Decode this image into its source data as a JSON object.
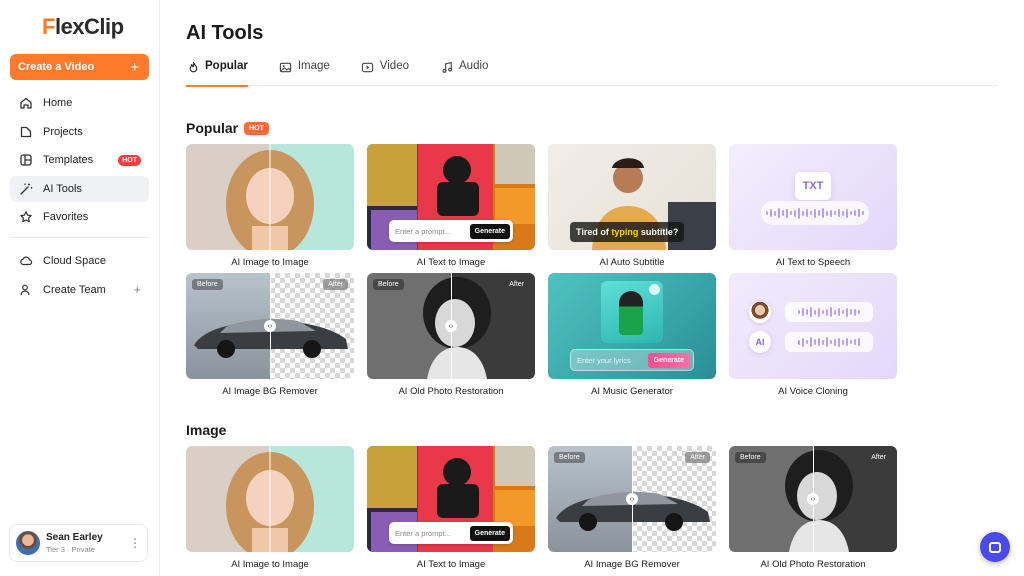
{
  "brand": {
    "logo_f": "F",
    "logo_rest": "lexClip"
  },
  "sidebar": {
    "create_label": "Create a Video",
    "items": [
      {
        "label": "Home",
        "icon": "home-icon"
      },
      {
        "label": "Projects",
        "icon": "folder-icon"
      },
      {
        "label": "Templates",
        "icon": "templates-icon",
        "badge": "HOT"
      },
      {
        "label": "AI Tools",
        "icon": "magic-wand-icon",
        "active": true
      },
      {
        "label": "Favorites",
        "icon": "star-icon"
      }
    ],
    "secondary": [
      {
        "label": "Cloud Space",
        "icon": "cloud-icon"
      },
      {
        "label": "Create Team",
        "icon": "team-icon"
      }
    ],
    "user": {
      "name": "Sean Earley",
      "tier": "Tier 3 · Private"
    }
  },
  "main": {
    "title": "AI Tools",
    "tabs": [
      {
        "label": "Popular",
        "icon": "flame-icon",
        "active": true
      },
      {
        "label": "Image",
        "icon": "image-icon"
      },
      {
        "label": "Video",
        "icon": "video-icon"
      },
      {
        "label": "Audio",
        "icon": "music-note-icon"
      }
    ],
    "popular": {
      "heading": "Popular",
      "badge": "HOT",
      "cards": [
        {
          "label": "AI Image to Image"
        },
        {
          "label": "AI Text to Image",
          "prompt_placeholder": "Enter a prompt...",
          "button": "Generate"
        },
        {
          "label": "AI Auto Subtitle",
          "caption_pre": "Tired of ",
          "caption_hl": "typing",
          "caption_post": " subtitle?"
        },
        {
          "label": "AI Text to Speech",
          "doc_text": "TXT"
        },
        {
          "label": "AI Image BG Remover",
          "before": "Before",
          "after": "After"
        },
        {
          "label": "AI Old Photo Restoration",
          "before": "Before",
          "after": "After"
        },
        {
          "label": "AI Music Generator",
          "prompt_placeholder": "Enter your lyrics",
          "button": "Generate"
        },
        {
          "label": "AI Voice Cloning",
          "ai_text": "AI"
        }
      ]
    },
    "image": {
      "heading": "Image",
      "cards": [
        {
          "label": "AI Image to Image"
        },
        {
          "label": "AI Text to Image",
          "prompt_placeholder": "Enter a prompt...",
          "button": "Generate"
        },
        {
          "label": "AI Image BG Remover",
          "before": "Before",
          "after": "After"
        },
        {
          "label": "AI Old Photo Restoration",
          "before": "Before",
          "after": "After"
        }
      ]
    }
  },
  "colors": {
    "accent": "#ff7a2c",
    "hot": "#ff3b3b",
    "help": "#4a4ae8"
  }
}
